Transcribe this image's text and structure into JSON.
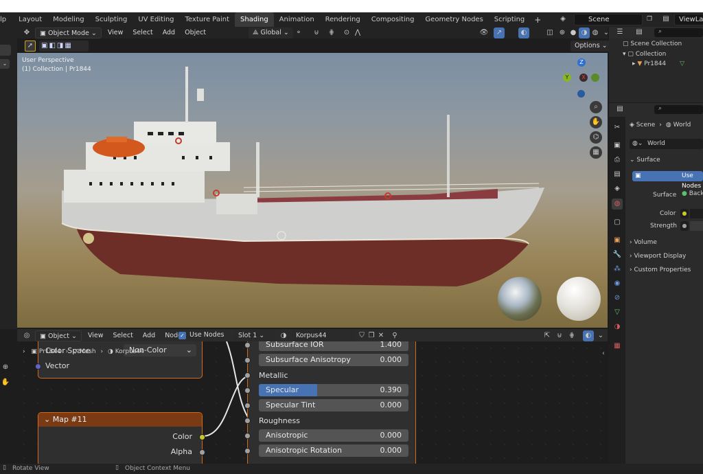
{
  "topbar": {
    "left_stub": "lp",
    "workspaces": [
      "Layout",
      "Modeling",
      "Sculpting",
      "UV Editing",
      "Texture Paint",
      "Shading",
      "Animation",
      "Rendering",
      "Compositing",
      "Geometry Nodes",
      "Scripting"
    ],
    "active_workspace": "Shading",
    "add_workspace": "+",
    "scene": "Scene",
    "view_layer": "ViewLayer"
  },
  "viewport_header": {
    "mode": "Object Mode",
    "menus": [
      "View",
      "Select",
      "Add",
      "Object"
    ],
    "transform_orientation": "Global",
    "options": "Options"
  },
  "viewport": {
    "perspective_label": "User Perspective",
    "collection_label": "(1) Collection | Pr1844",
    "gizmo": {
      "z": "Z",
      "y": "Y",
      "x": "X"
    }
  },
  "node_header": {
    "type": "Object",
    "menus": [
      "View",
      "Select",
      "Add",
      "Node"
    ],
    "use_nodes": "Use Nodes",
    "slot": "Slot 1",
    "material": "Korpus44"
  },
  "breadcrumb": {
    "items": [
      "Pr1844",
      "Mesh",
      "Korpus44"
    ]
  },
  "nodes": {
    "image_node": {
      "color_space_label": "Color Space",
      "color_space_value": "Non-Color",
      "vector": "Vector"
    },
    "map_node": {
      "title": "Map #11",
      "color": "Color",
      "alpha": "Alpha"
    },
    "bsdf": {
      "rows": [
        {
          "label": "Subsurface IOR",
          "value": "1.400",
          "type": "field"
        },
        {
          "label": "Subsurface Anisotropy",
          "value": "0.000",
          "type": "field"
        },
        {
          "label": "Metallic",
          "value": "",
          "type": "socket"
        },
        {
          "label": "Specular",
          "value": "0.390",
          "type": "slider",
          "fill": 0.39
        },
        {
          "label": "Specular Tint",
          "value": "0.000",
          "type": "field"
        },
        {
          "label": "Roughness",
          "value": "",
          "type": "socket"
        },
        {
          "label": "Anisotropic",
          "value": "0.000",
          "type": "field"
        },
        {
          "label": "Anisotropic Rotation",
          "value": "0.000",
          "type": "field"
        }
      ]
    }
  },
  "outliner": {
    "scene_collection": "Scene Collection",
    "collection": "Collection",
    "object": "Pr1844"
  },
  "properties": {
    "breadcrumb_scene": "Scene",
    "breadcrumb_world": "World",
    "world_name": "World",
    "panel_surface": "Surface",
    "use_nodes_button": "Use Nodes",
    "surface_label": "Surface",
    "surface_value": "Background",
    "color_label": "Color",
    "strength_label": "Strength",
    "panel_volume": "Volume",
    "panel_viewport_display": "Viewport Display",
    "panel_custom_properties": "Custom Properties"
  },
  "statusbar": {
    "left": "Rotate View",
    "middle": "Object Context Menu"
  },
  "colors": {
    "accent_blue": "#4772b3",
    "node_border": "#d46b18",
    "socket_yellow": "#c7c729",
    "socket_gray": "#a1a1a1",
    "socket_purple": "#6363c7",
    "hull_red": "#6e2e28"
  }
}
